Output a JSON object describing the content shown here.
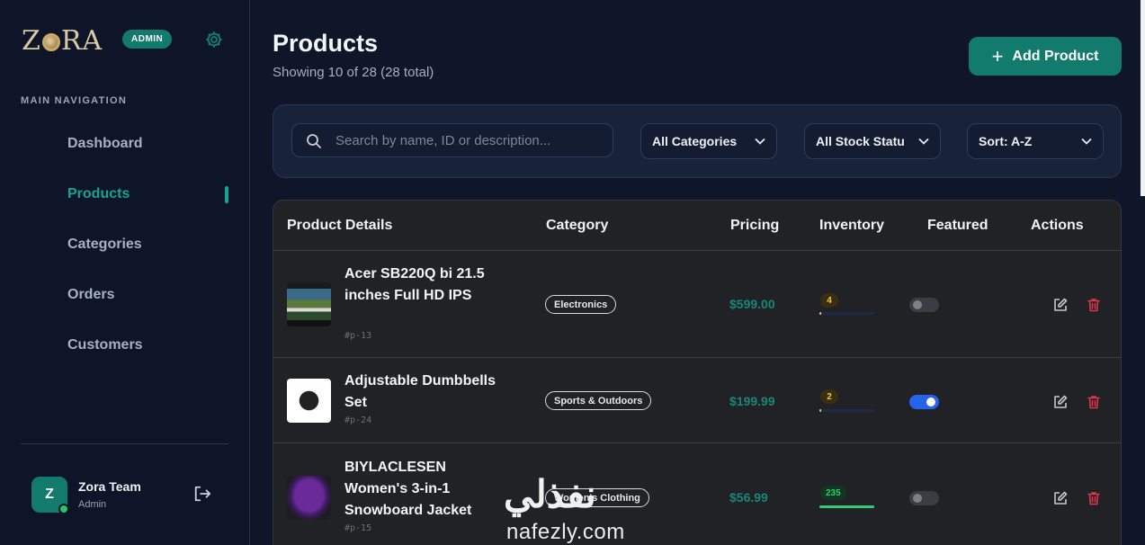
{
  "sidebar": {
    "logo": {
      "text_left": "Z",
      "text_right": "RA"
    },
    "badge": "ADMIN",
    "nav_heading": "MAIN NAVIGATION",
    "items": [
      {
        "label": "Dashboard",
        "active": false
      },
      {
        "label": "Products",
        "active": true
      },
      {
        "label": "Categories",
        "active": false
      },
      {
        "label": "Orders",
        "active": false
      },
      {
        "label": "Customers",
        "active": false
      }
    ],
    "user": {
      "initial": "Z",
      "name": "Zora Team",
      "role": "Admin",
      "status": "online"
    }
  },
  "header": {
    "title": "Products",
    "subtitle": "Showing 10 of 28 (28 total)",
    "add_button": "Add Product"
  },
  "filters": {
    "search_placeholder": "Search by name, ID or description...",
    "category": "All Categories",
    "stock": "All Stock Statu",
    "sort": "Sort: A-Z"
  },
  "table": {
    "columns": [
      "Product Details",
      "Category",
      "Pricing",
      "Inventory",
      "Featured",
      "Actions"
    ],
    "rows": [
      {
        "name": "Acer SB220Q bi 21.5 inches Full HD IPS",
        "id": "#p-13",
        "category": "Electronics",
        "price": "$599.00",
        "stock": "4",
        "stock_level": 0.02,
        "stock_state": "low",
        "featured": false,
        "thumb": "monitor-image"
      },
      {
        "name": "Adjustable Dumbbells Set",
        "id": "#p-24",
        "category": "Sports & Outdoors",
        "price": "$199.99",
        "stock": "2",
        "stock_level": 0.01,
        "stock_state": "low",
        "featured": true,
        "thumb": "dumbbells-image"
      },
      {
        "name": "BIYLACLESEN Women's 3-in-1 Snowboard Jacket",
        "id": "#p-15",
        "category": "Women's Clothing",
        "price": "$56.99",
        "stock": "235",
        "stock_level": 1.0,
        "stock_state": "good",
        "featured": false,
        "thumb": "jacket-image"
      }
    ]
  },
  "watermark": {
    "arabic": "نفذلي",
    "latin": "nafezly.com"
  },
  "colors": {
    "accent": "#137a6e",
    "accent_text": "#16a394",
    "toggle_on": "#2563eb",
    "delete": "#dc3545",
    "stock_low": "#f5c542",
    "stock_good": "#2ecc71"
  }
}
